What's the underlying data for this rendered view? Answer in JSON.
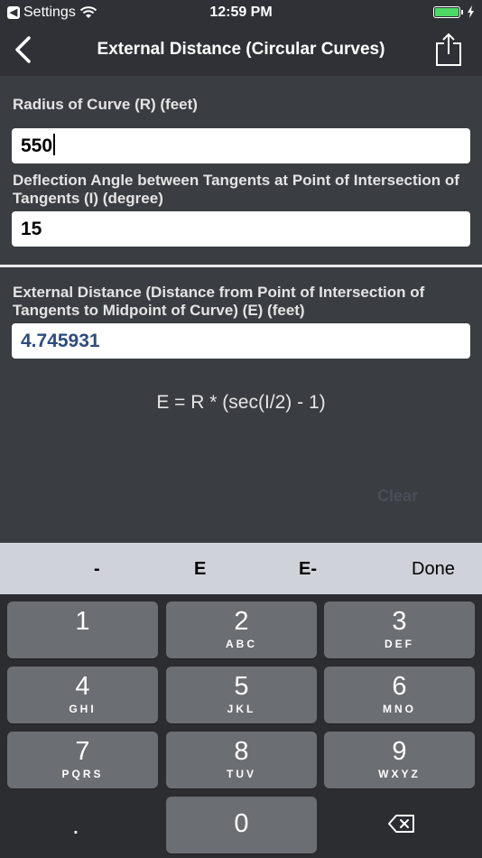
{
  "status_bar": {
    "back_app": "Settings",
    "time": "12:59 PM"
  },
  "nav": {
    "title": "External Distance (Circular Curves)"
  },
  "inputs": [
    {
      "label": "Radius of Curve (R) (feet)",
      "value": "550"
    },
    {
      "label": "Deflection Angle between Tangents at Point of Intersection of Tangents (I) (degree)",
      "value": "15"
    }
  ],
  "output": {
    "label": "External Distance (Distance from Point of Intersection of Tangents to Midpoint of Curve) (E) (feet)",
    "value": "4.745931"
  },
  "formula": "E = R * (sec(I/2) - 1)",
  "clear_label": "Clear",
  "accessory": {
    "minus": "-",
    "e": "E",
    "e_minus": "E-",
    "done": "Done"
  },
  "keys": [
    {
      "num": "1",
      "letters": ""
    },
    {
      "num": "2",
      "letters": "ABC"
    },
    {
      "num": "3",
      "letters": "DEF"
    },
    {
      "num": "4",
      "letters": "GHI"
    },
    {
      "num": "5",
      "letters": "JKL"
    },
    {
      "num": "6",
      "letters": "MNO"
    },
    {
      "num": "7",
      "letters": "PQRS"
    },
    {
      "num": "8",
      "letters": "TUV"
    },
    {
      "num": "9",
      "letters": "WXYZ"
    },
    {
      "num": "0",
      "letters": ""
    }
  ],
  "dot_key": ".",
  "colors": {
    "battery": "#4cd964",
    "result_text": "#2e4b7e",
    "background": "#3a3d42"
  }
}
